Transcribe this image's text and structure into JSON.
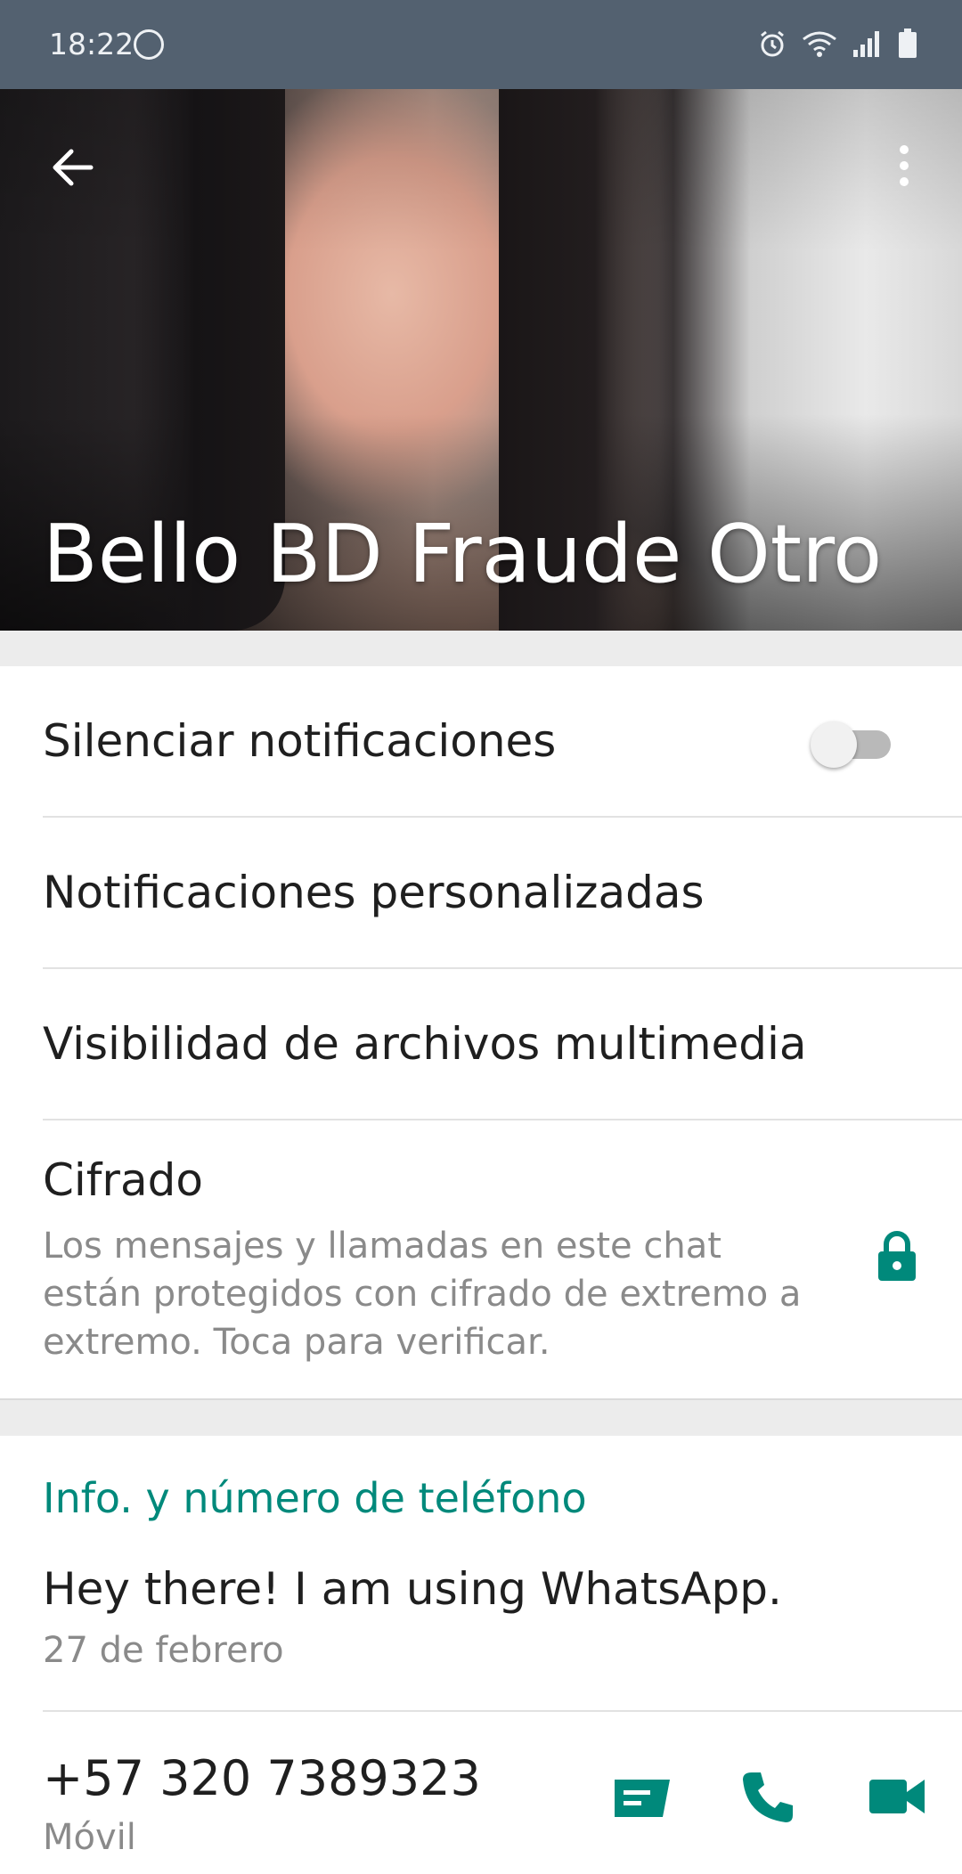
{
  "status_bar": {
    "time": "18:22",
    "left_icons": [
      "running-icon"
    ],
    "right_icons": [
      "alarm-icon",
      "wifi-icon",
      "signal-icon",
      "battery-icon"
    ]
  },
  "header": {
    "contact_name": "Bello BD Fraude Otro",
    "back_icon": "arrow-back-icon",
    "menu_icon": "more-vertical-icon"
  },
  "settings": {
    "mute_label": "Silenciar notificaciones",
    "mute_enabled": false,
    "custom_notifications_label": "Notificaciones personalizadas",
    "media_visibility_label": "Visibilidad de archivos multimedia",
    "encryption_title": "Cifrado",
    "encryption_description": "Los mensajes y llamadas en este chat están protegidos con cifrado de extremo a extremo. Toca para verificar."
  },
  "info": {
    "section_title": "Info. y número de teléfono",
    "about": "Hey there! I am using WhatsApp.",
    "about_date": "27 de febrero",
    "phone": "+57 320 7389323",
    "phone_type": "Móvil"
  },
  "colors": {
    "accent": "#00897b",
    "status_bar": "#536170",
    "divider": "#e2e2e2",
    "section_gap": "#ececec"
  }
}
